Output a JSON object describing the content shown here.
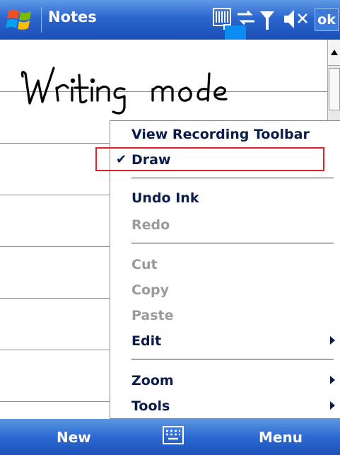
{
  "titlebar": {
    "app_title": "Notes",
    "ok_label": "ok",
    "status_icons": [
      "input-panel-icon",
      "connectivity-icon",
      "signal-antenna-icon",
      "volume-icon"
    ]
  },
  "note": {
    "handwritten_text": "Writing mode"
  },
  "menu": {
    "items": [
      {
        "label": "View Recording Toolbar",
        "enabled": true,
        "checked": false,
        "submenu": false
      },
      {
        "label": "Draw",
        "enabled": true,
        "checked": true,
        "submenu": false
      },
      {
        "label": "Undo Ink",
        "enabled": true,
        "checked": false,
        "submenu": false
      },
      {
        "label": "Redo",
        "enabled": false,
        "checked": false,
        "submenu": false
      },
      {
        "label": "Cut",
        "enabled": false,
        "checked": false,
        "submenu": false
      },
      {
        "label": "Copy",
        "enabled": false,
        "checked": false,
        "submenu": false
      },
      {
        "label": "Paste",
        "enabled": false,
        "checked": false,
        "submenu": false
      },
      {
        "label": "Edit",
        "enabled": true,
        "checked": false,
        "submenu": true
      },
      {
        "label": "Zoom",
        "enabled": true,
        "checked": false,
        "submenu": true
      },
      {
        "label": "Tools",
        "enabled": true,
        "checked": false,
        "submenu": true
      }
    ],
    "check_glyph": "✔"
  },
  "bottombar": {
    "left_softkey": "New",
    "right_softkey": "Menu"
  },
  "colors": {
    "titlebar_blue": "#2a66cf",
    "highlight_red": "#e0202e",
    "accent_square": "#0a8cf0"
  }
}
